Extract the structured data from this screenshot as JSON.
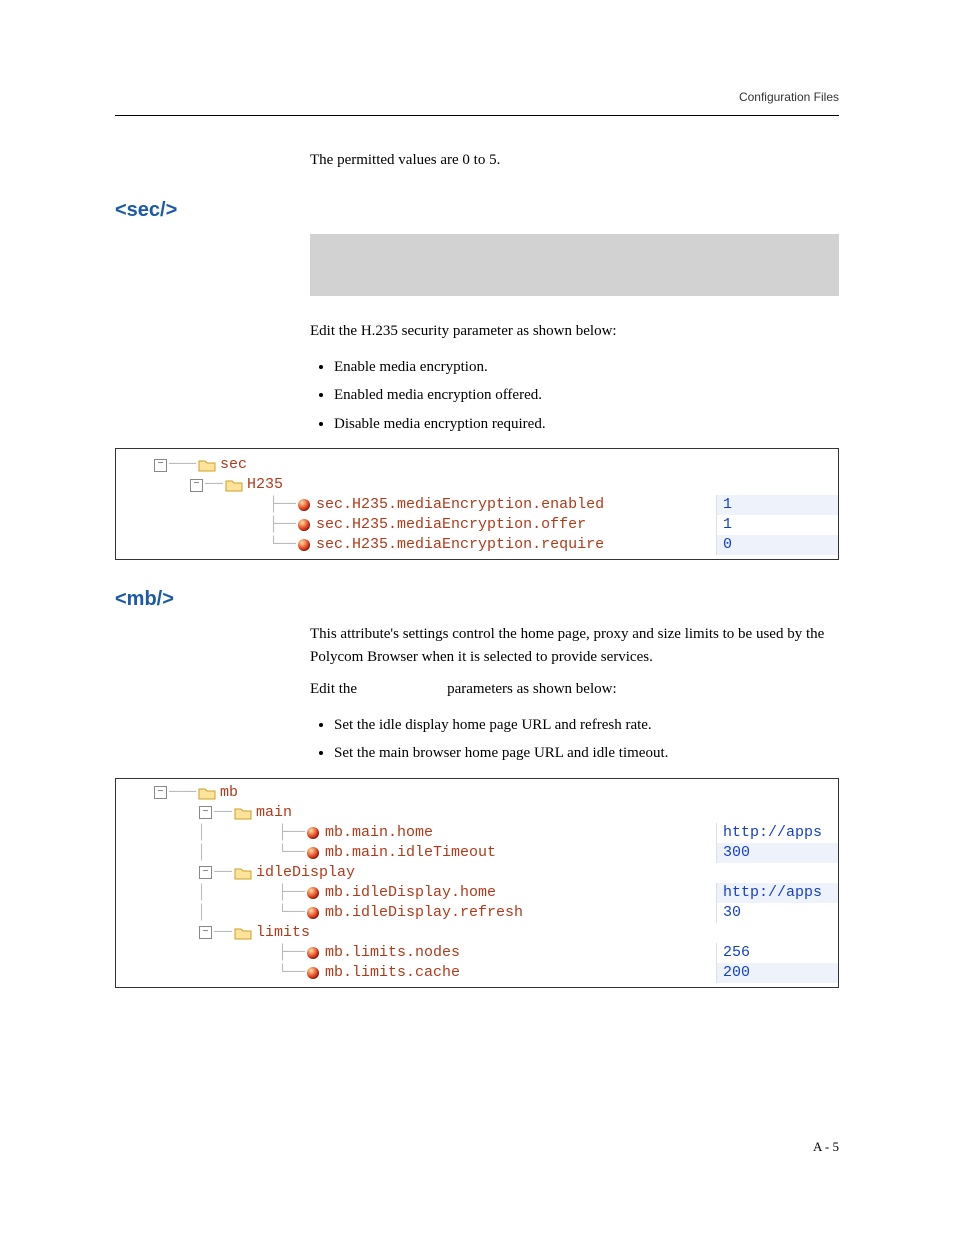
{
  "header": {
    "right_label": "Configuration Files"
  },
  "intro": {
    "text": "The permitted values are 0 to 5."
  },
  "sec": {
    "heading": "<sec/>",
    "edit_text": "Edit the H.235 security parameter as shown below:",
    "bullets": [
      "Enable media encryption.",
      "Enabled media encryption offered.",
      "Disable media encryption required."
    ],
    "tree": {
      "root": "sec",
      "child": "H235",
      "rows": [
        {
          "key": "sec.H235.mediaEncryption.enabled",
          "val": "1"
        },
        {
          "key": "sec.H235.mediaEncryption.offer",
          "val": "1"
        },
        {
          "key": "sec.H235.mediaEncryption.require",
          "val": "0"
        }
      ]
    }
  },
  "mb": {
    "heading": "<mb/>",
    "para1": "This attribute's settings control the home page, proxy and size limits to be used by the Polycom Browser when it is selected to provide services.",
    "edit_prefix": "Edit the ",
    "edit_suffix": " parameters as shown below:",
    "bullets": [
      "Set the idle display home page URL and refresh rate.",
      "Set the main browser home page URL and idle timeout."
    ],
    "tree": {
      "root": "mb",
      "groups": [
        {
          "name": "main",
          "rows": [
            {
              "key": "mb.main.home",
              "val": "http://apps"
            },
            {
              "key": "mb.main.idleTimeout",
              "val": "300"
            }
          ]
        },
        {
          "name": "idleDisplay",
          "rows": [
            {
              "key": "mb.idleDisplay.home",
              "val": "http://apps"
            },
            {
              "key": "mb.idleDisplay.refresh",
              "val": "30"
            }
          ]
        },
        {
          "name": "limits",
          "rows": [
            {
              "key": "mb.limits.nodes",
              "val": "256"
            },
            {
              "key": "mb.limits.cache",
              "val": "200"
            }
          ]
        }
      ]
    }
  },
  "footer": {
    "page": "A - 5"
  }
}
